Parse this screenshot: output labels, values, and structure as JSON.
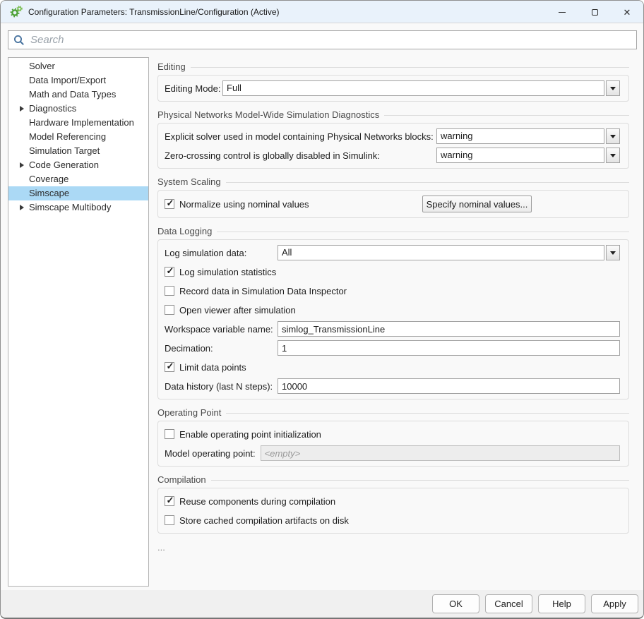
{
  "window": {
    "title": "Configuration Parameters: TransmissionLine/Configuration (Active)"
  },
  "search": {
    "placeholder": "Search"
  },
  "sidebar": {
    "items": [
      {
        "label": "Solver",
        "expandable": false,
        "selected": false
      },
      {
        "label": "Data Import/Export",
        "expandable": false,
        "selected": false
      },
      {
        "label": "Math and Data Types",
        "expandable": false,
        "selected": false
      },
      {
        "label": "Diagnostics",
        "expandable": true,
        "selected": false
      },
      {
        "label": "Hardware Implementation",
        "expandable": false,
        "selected": false
      },
      {
        "label": "Model Referencing",
        "expandable": false,
        "selected": false
      },
      {
        "label": "Simulation Target",
        "expandable": false,
        "selected": false
      },
      {
        "label": "Code Generation",
        "expandable": true,
        "selected": false
      },
      {
        "label": "Coverage",
        "expandable": false,
        "selected": false
      },
      {
        "label": "Simscape",
        "expandable": false,
        "selected": true
      },
      {
        "label": "Simscape Multibody",
        "expandable": true,
        "selected": false
      }
    ]
  },
  "sections": [
    {
      "title": "Editing",
      "rows": [
        {
          "type": "dropdown",
          "label": "Editing Mode:",
          "value": "Full"
        }
      ]
    },
    {
      "title": "Physical Networks Model-Wide Simulation Diagnostics",
      "rows": [
        {
          "type": "dropdown",
          "label": "Explicit solver used in model containing Physical Networks blocks:",
          "value": "warning"
        },
        {
          "type": "dropdown",
          "label": "Zero-crossing control is globally disabled in Simulink:",
          "value": "warning"
        }
      ]
    },
    {
      "title": "System Scaling",
      "rows": [
        {
          "type": "checkbox_button",
          "label": "Normalize using nominal values",
          "checked": true,
          "button": "Specify nominal values..."
        }
      ]
    },
    {
      "title": "Data Logging",
      "rows": [
        {
          "type": "dropdown",
          "label": "Log simulation data:",
          "value": "All"
        },
        {
          "type": "checkbox",
          "label": "Log simulation statistics",
          "checked": true
        },
        {
          "type": "checkbox",
          "label": "Record data in Simulation Data Inspector",
          "checked": false
        },
        {
          "type": "checkbox",
          "label": "Open viewer after simulation",
          "checked": false
        },
        {
          "type": "input",
          "label": "Workspace variable name:",
          "value": "simlog_TransmissionLine"
        },
        {
          "type": "input",
          "label": "Decimation:",
          "value": "1"
        },
        {
          "type": "checkbox",
          "label": "Limit data points",
          "checked": true
        },
        {
          "type": "input",
          "label": "Data history (last N steps):",
          "value": "10000"
        }
      ]
    },
    {
      "title": "Operating Point",
      "rows": [
        {
          "type": "checkbox",
          "label": "Enable operating point initialization",
          "checked": false
        },
        {
          "type": "input",
          "label": "Model operating point:",
          "value": "<empty>",
          "disabled": true
        }
      ]
    },
    {
      "title": "Compilation",
      "rows": [
        {
          "type": "checkbox",
          "label": "Reuse components during compilation",
          "checked": true
        },
        {
          "type": "checkbox",
          "label": "Store cached compilation artifacts on disk",
          "checked": false
        }
      ]
    }
  ],
  "more_indicator": "...",
  "footer": {
    "buttons": [
      "OK",
      "Cancel",
      "Help",
      "Apply"
    ]
  },
  "colors": {
    "titlebar": "#e9f2fb",
    "selection": "#abd9f5",
    "footer": "#f0f0f0",
    "search_icon": "#44709d",
    "gear_icon": "#4ca135"
  }
}
